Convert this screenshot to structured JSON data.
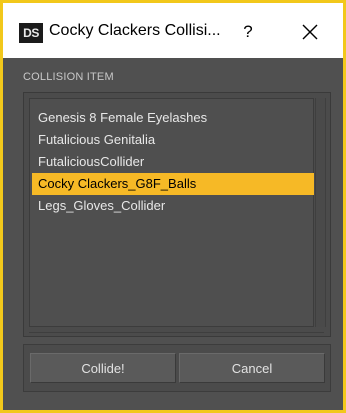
{
  "window": {
    "title": "Cocky Clackers Collisi...",
    "app_icon_text": "DS",
    "help_symbol": "?",
    "accent_color": "#f2c81b"
  },
  "section": {
    "label": "COLLISION ITEM"
  },
  "list": {
    "items": [
      {
        "label": "Genesis 8 Female Eyelashes",
        "selected": false
      },
      {
        "label": "Futalicious Genitalia",
        "selected": false
      },
      {
        "label": "FutaliciousCollider",
        "selected": false
      },
      {
        "label": "Cocky Clackers_G8F_Balls",
        "selected": true
      },
      {
        "label": "Legs_Gloves_Collider",
        "selected": false
      }
    ],
    "selection_color": "#f6b926"
  },
  "buttons": {
    "collide_label": "Collide!",
    "cancel_label": "Cancel"
  }
}
